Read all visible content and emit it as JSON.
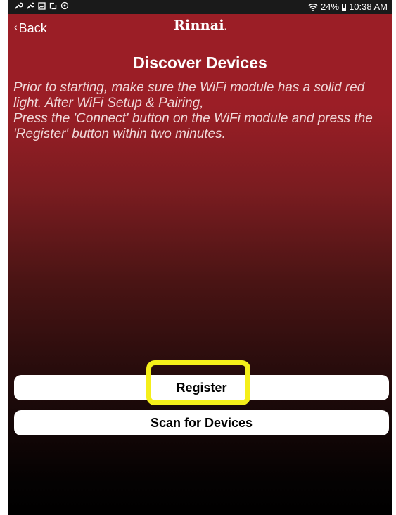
{
  "status_bar": {
    "left_icons": [
      "wrench-icon",
      "wrench-icon",
      "image-icon",
      "screenshot-icon",
      "sync-icon"
    ],
    "battery": "24%",
    "time": "10:38 AM"
  },
  "navbar": {
    "back_label": "Back",
    "brand": "Rinnai"
  },
  "page": {
    "title": "Discover Devices",
    "instructions_line1": "Prior to starting, make sure the WiFi module has a solid red light. After WiFi Setup & Pairing,",
    "instructions_line2": "Press the 'Connect' button on the WiFi module and press the 'Register' button within two minutes."
  },
  "buttons": {
    "register_label": "Register",
    "scan_label": "Scan for Devices"
  },
  "colors": {
    "header_red": "#9b1e26",
    "highlight_yellow": "#f5ef1a"
  }
}
